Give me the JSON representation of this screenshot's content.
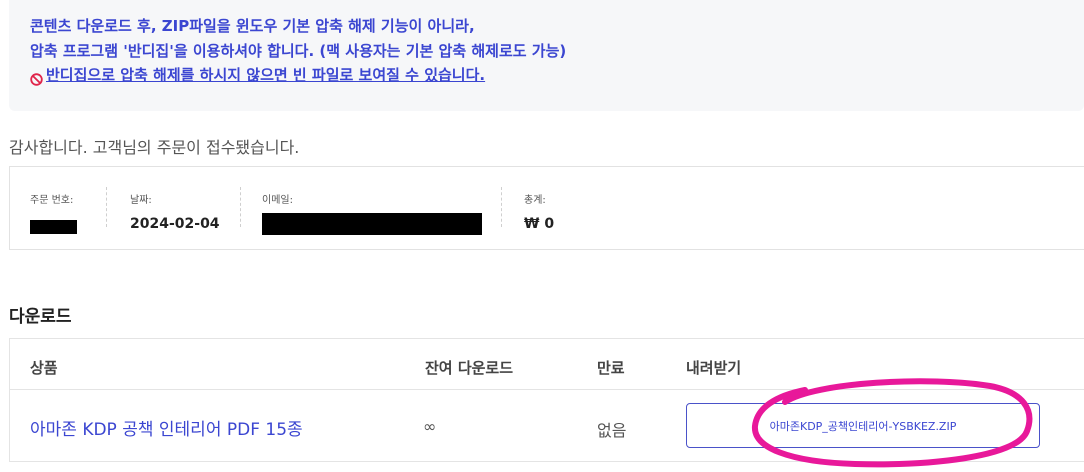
{
  "notice": {
    "line1": "콘텐츠 다운로드 후, ZIP파일을 윈도우 기본 압축 해제 기능이 아니라,",
    "line2": "압축 프로그램 '반디집'을 이용하셔야 합니다. (맥 사용자는 기본 압축 해제로도 가능)",
    "warning": "반디집으로 압축 해제를 하시지 않으면 빈 파일로 보여질 수 있습니다."
  },
  "thanks": "감사합니다. 고객님의 주문이 접수됐습니다.",
  "order": {
    "number_label": "주문 번호:",
    "date_label": "날짜:",
    "date_value": "2024-02-04",
    "email_label": "이메일:",
    "total_label": "총계:",
    "total_value": "₩ 0"
  },
  "downloads": {
    "title": "다운로드",
    "headers": {
      "product": "상품",
      "remaining": "잔여 다운로드",
      "expires": "만료",
      "download": "내려받기"
    },
    "rows": [
      {
        "product": "아마존 KDP 공책 인테리어 PDF 15종",
        "remaining": "∞",
        "expires": "없음",
        "file": "아마존KDP_공책인테리어-YSBKEZ.ZIP"
      }
    ]
  },
  "colors": {
    "accent": "#3b46d1",
    "annotation": "#e8189a",
    "notice_bg": "#f6f7f9"
  }
}
